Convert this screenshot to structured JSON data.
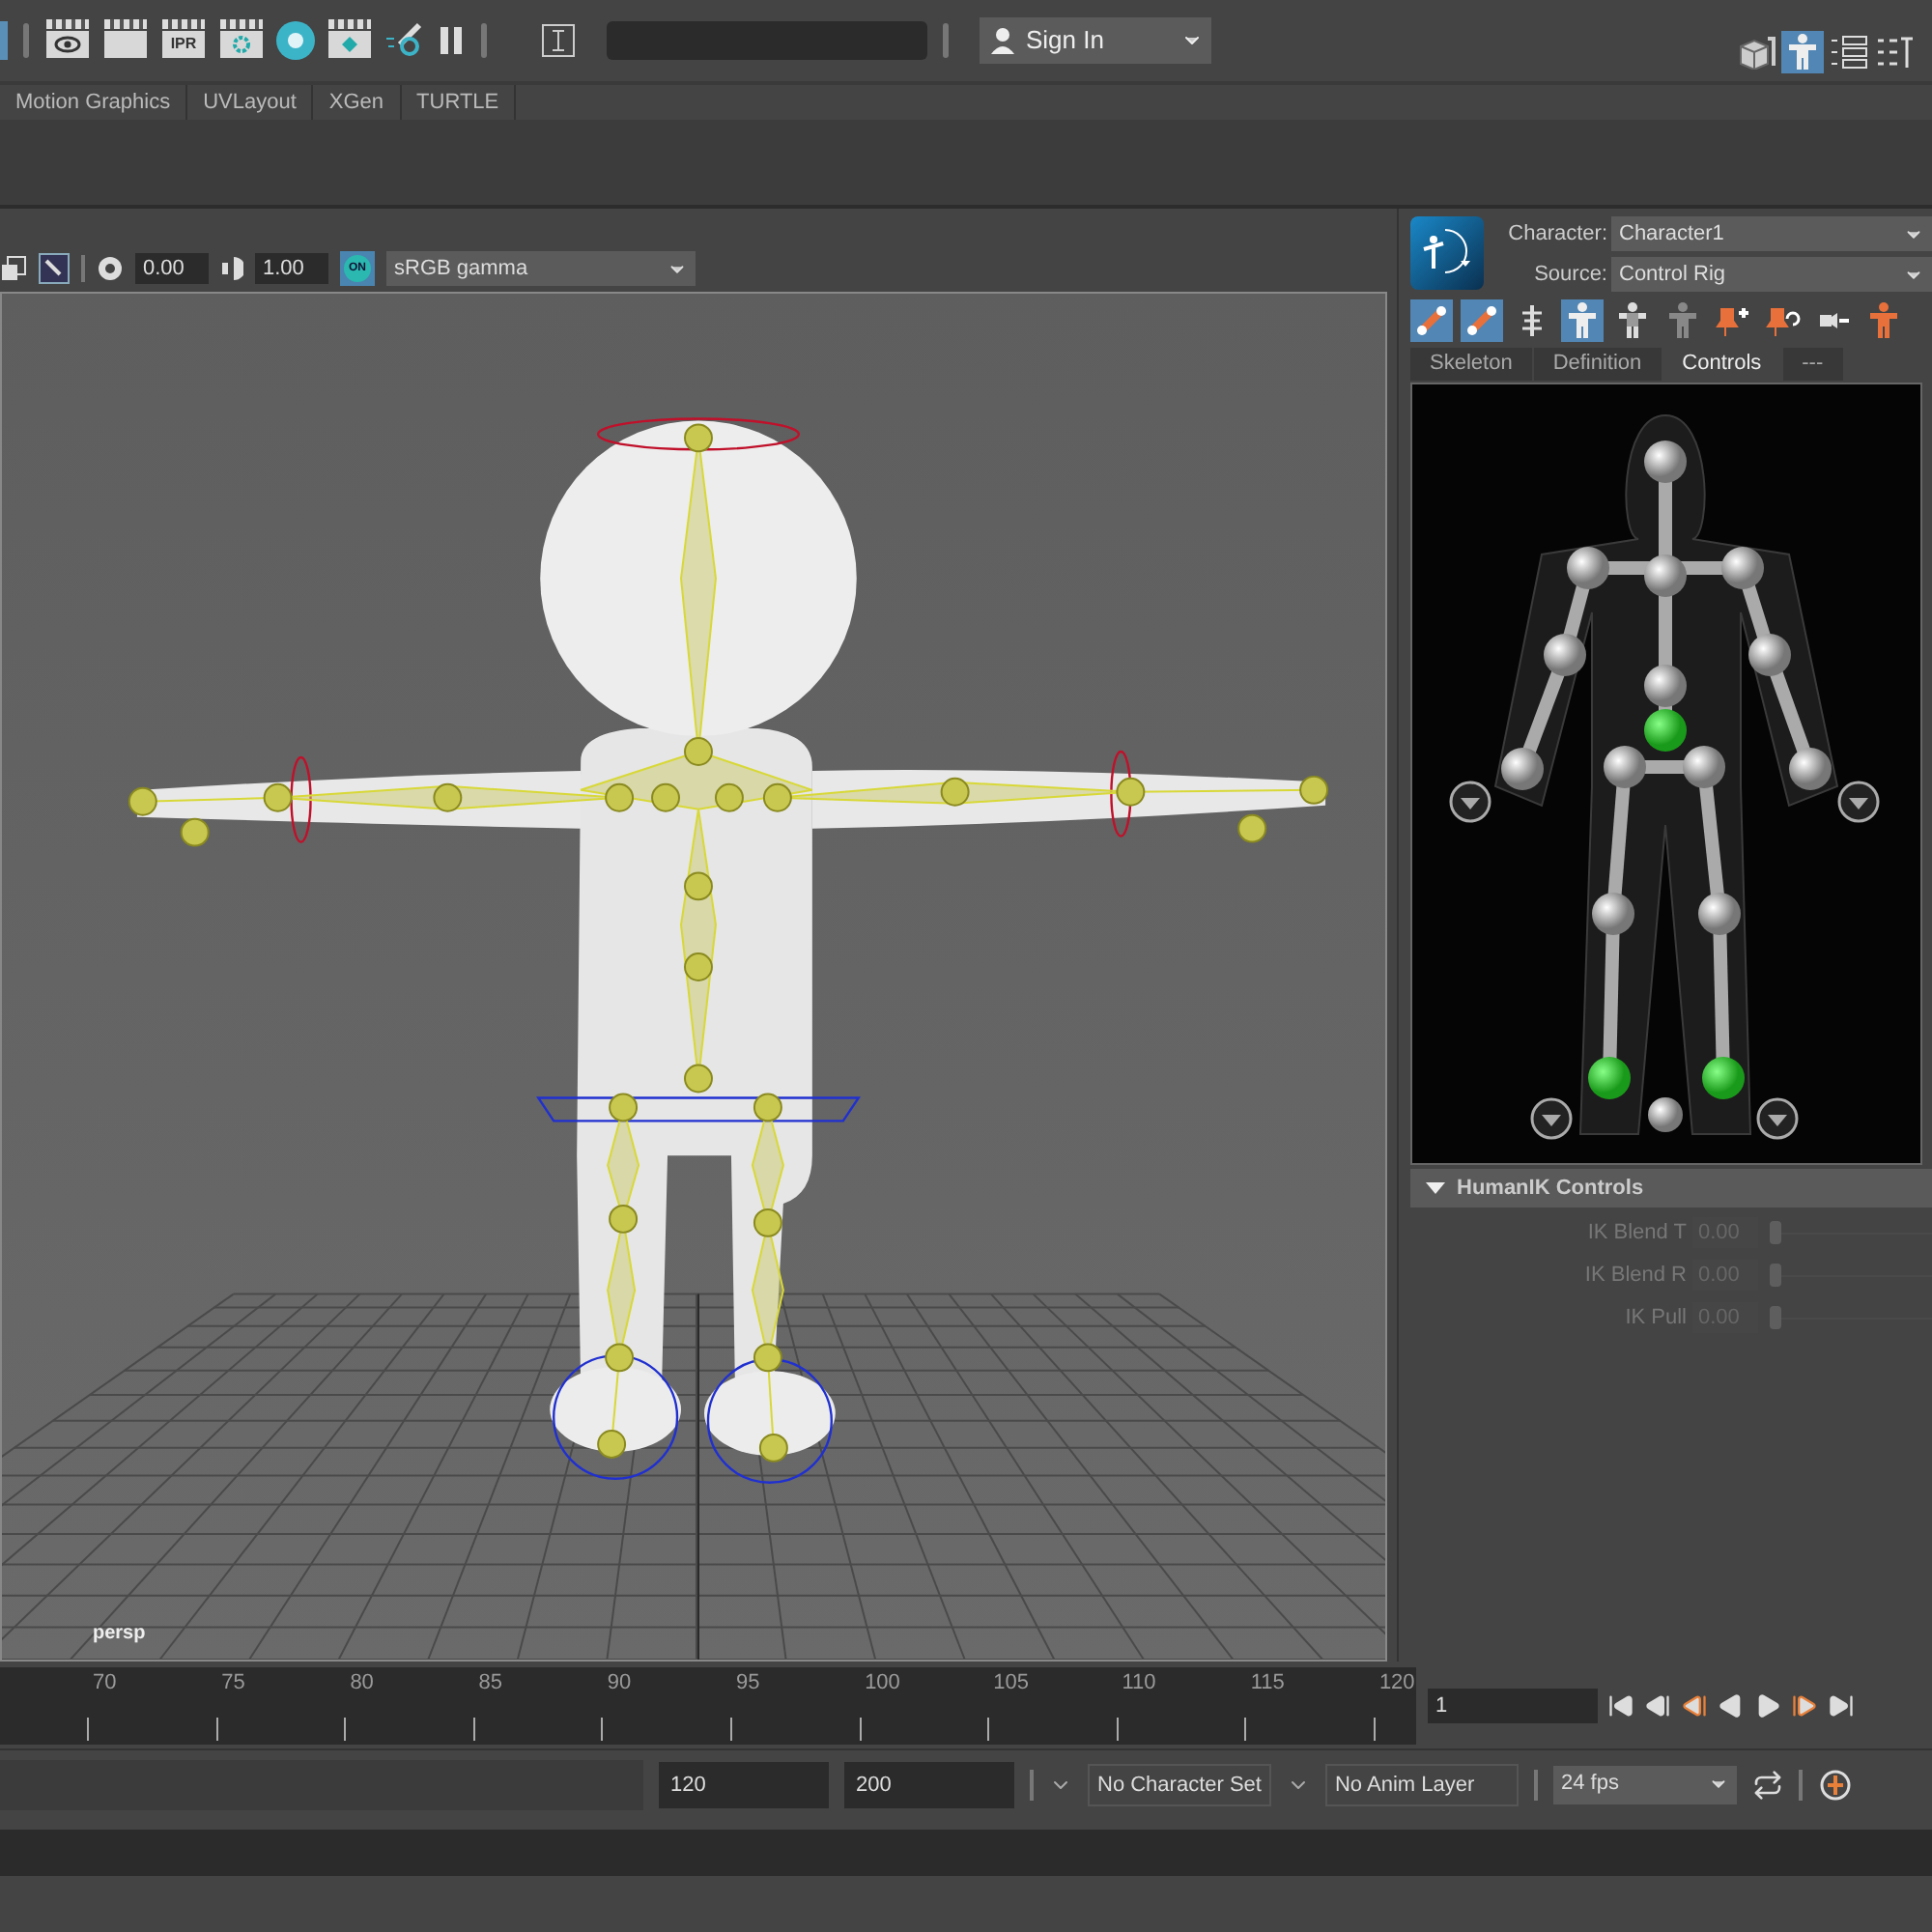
{
  "toolbar": {
    "ipr_badge": "IPR",
    "sign_in": "Sign In",
    "workspace_tools": [
      {
        "kind": "cube",
        "selected": false
      },
      {
        "kind": "figure",
        "selected": true
      },
      {
        "kind": "channels",
        "selected": false
      },
      {
        "kind": "attributes",
        "selected": false
      }
    ]
  },
  "shelf_tabs": [
    "Motion Graphics",
    "UVLayout",
    "XGen",
    "TURTLE"
  ],
  "viewport": {
    "exposure": "0.00",
    "gamma": "1.00",
    "on_badge": "ON",
    "color_space": "sRGB gamma",
    "camera": "persp"
  },
  "hik": {
    "character_label": "Character:",
    "character": "Character1",
    "source_label": "Source:",
    "source": "Control Rig",
    "tools": [
      {
        "kind": "bone",
        "selected": true
      },
      {
        "kind": "bone",
        "selected": true
      },
      {
        "kind": "spine",
        "selected": false
      },
      {
        "kind": "body-full",
        "selected": true
      },
      {
        "kind": "body-partial",
        "selected": false
      },
      {
        "kind": "body-ghost",
        "selected": false
      },
      {
        "kind": "pin-add",
        "selected": false
      },
      {
        "kind": "pin-reset",
        "selected": false
      },
      {
        "kind": "pin-remove",
        "selected": false
      },
      {
        "kind": "body-orange",
        "selected": false
      }
    ],
    "tabs": [
      {
        "label": "Skeleton",
        "selected": false
      },
      {
        "label": "Definition",
        "selected": false
      },
      {
        "label": "Controls",
        "selected": true
      },
      {
        "label": "---",
        "selected": false
      }
    ],
    "section": "HumanIK Controls",
    "section_expanded": true,
    "controls": [
      {
        "label": "IK Blend T",
        "value": "0.00",
        "level": 0,
        "disabled": true
      },
      {
        "label": "IK Blend R",
        "value": "0.00",
        "level": 0,
        "disabled": true
      },
      {
        "label": "IK Pull",
        "value": "0.00",
        "level": 0,
        "disabled": true
      }
    ]
  },
  "timeline": {
    "ticks": [
      "70",
      "75",
      "80",
      "85",
      "90",
      "95",
      "100",
      "105",
      "110",
      "115",
      "120"
    ],
    "current_frame": "1"
  },
  "range": {
    "end": "120",
    "max_end": "200",
    "character_set": "No Character Set",
    "anim_layer": "No Anim Layer",
    "fps": "24 fps"
  }
}
